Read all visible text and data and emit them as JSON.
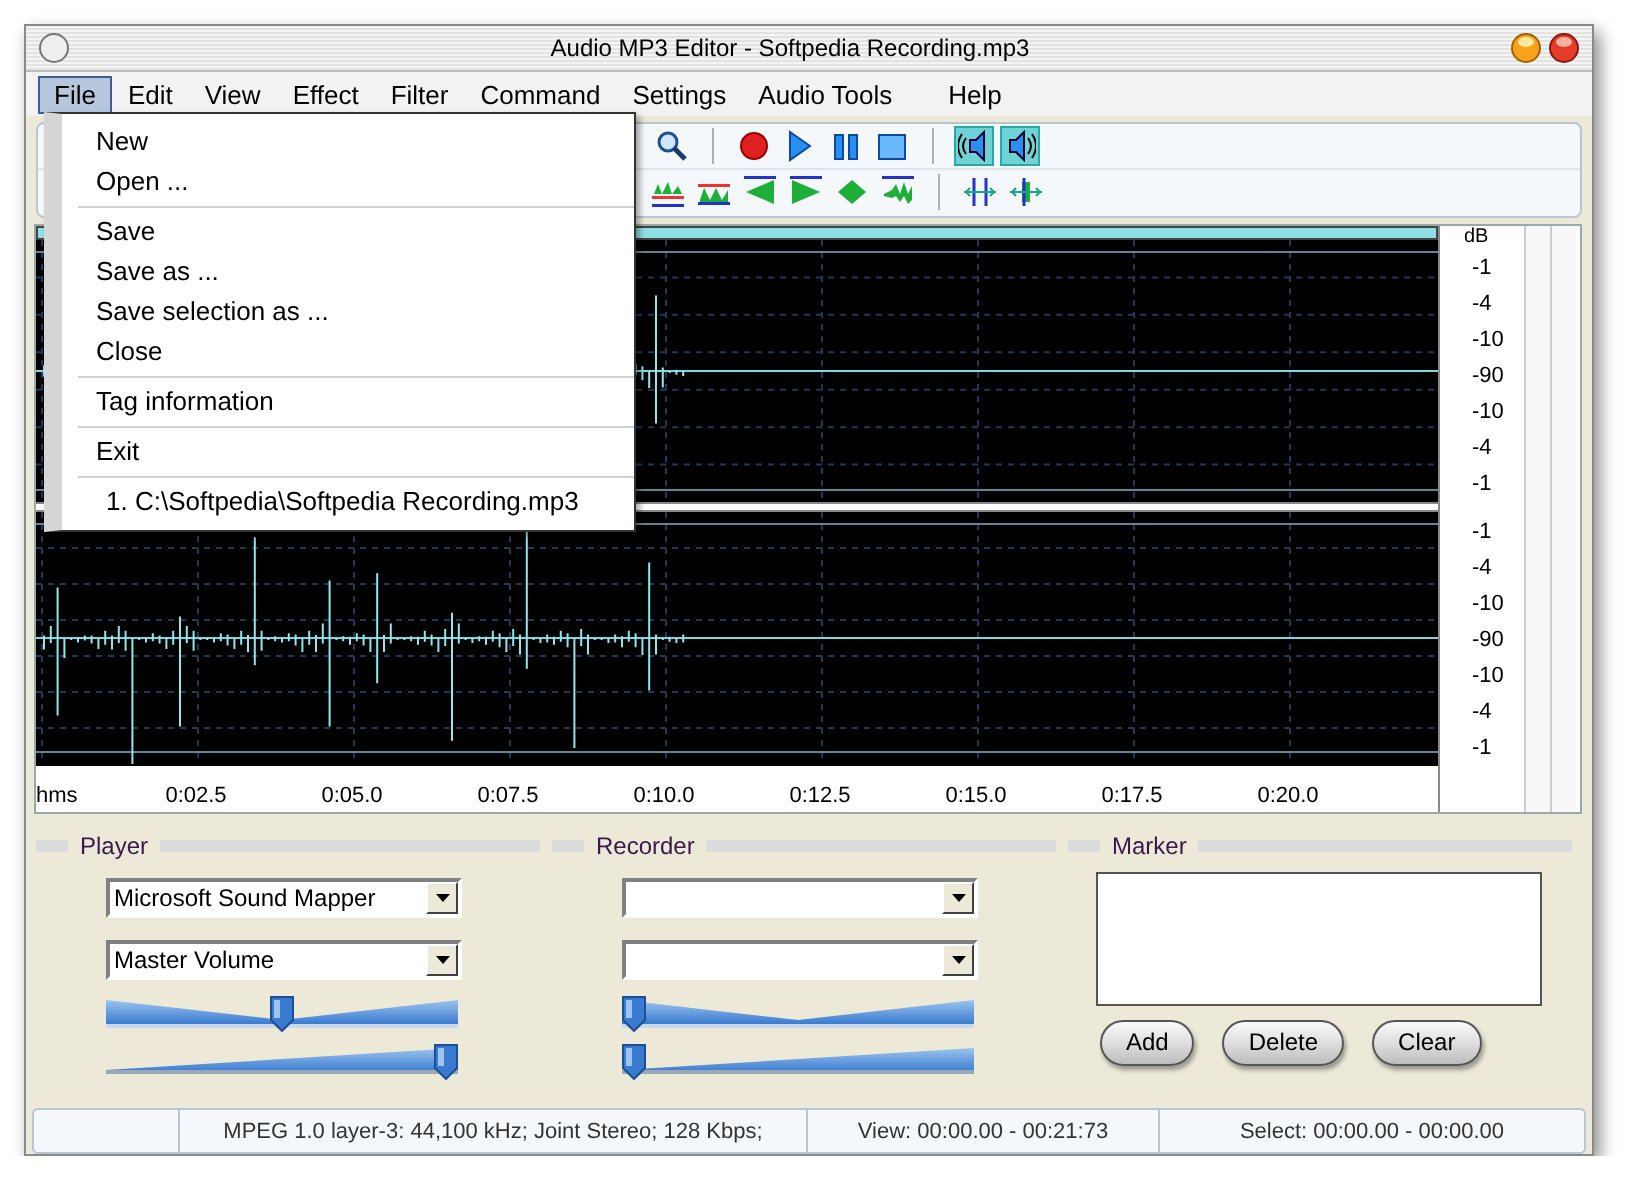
{
  "window": {
    "title": "Audio MP3 Editor - Softpedia Recording.mp3"
  },
  "menu_bar": [
    {
      "label": "File",
      "selected": true
    },
    {
      "label": "Edit",
      "selected": false
    },
    {
      "label": "View",
      "selected": false
    },
    {
      "label": "Effect",
      "selected": false
    },
    {
      "label": "Filter",
      "selected": false
    },
    {
      "label": "Command",
      "selected": false
    },
    {
      "label": "Settings",
      "selected": false
    },
    {
      "label": "Audio Tools",
      "selected": false
    },
    {
      "label": "Help",
      "selected": false
    }
  ],
  "file_menu": {
    "groups": [
      {
        "kind": "command",
        "items": [
          "New",
          "Open ..."
        ]
      },
      {
        "kind": "command",
        "items": [
          "Save",
          "Save as ...",
          "Save selection as ...",
          "Close"
        ]
      },
      {
        "kind": "command",
        "items": [
          "Tag information"
        ]
      },
      {
        "kind": "command",
        "items": [
          "Exit"
        ]
      },
      {
        "kind": "recent",
        "items": [
          "1. C:\\Softpedia\\Softpedia Recording.mp3"
        ]
      }
    ]
  },
  "toolbar": {
    "channel_toggles": [
      {
        "on": true
      },
      {
        "on": true
      }
    ]
  },
  "waveform": {
    "db_label": "dB",
    "channels": [
      {
        "db_ticks": [
          "-1",
          "-4",
          "-10",
          "-90",
          "-10",
          "-4",
          "-1"
        ]
      },
      {
        "db_ticks": [
          "-1",
          "-4",
          "-10",
          "-90",
          "-10",
          "-4",
          "-1"
        ]
      }
    ],
    "time_ruler": [
      "hms",
      "0:02.5",
      "0:05.0",
      "0:07.5",
      "0:10.0",
      "0:12.5",
      "0:15.0",
      "0:17.5",
      "0:20.0"
    ]
  },
  "player": {
    "title": "Player",
    "dropdowns": [
      {
        "kind": "device",
        "value": "Microsoft Sound Mapper"
      },
      {
        "kind": "mixer",
        "value": "Master Volume"
      }
    ],
    "sliders": [
      {
        "kind": "balance",
        "level": 0.5
      },
      {
        "kind": "volume",
        "level": 1
      }
    ]
  },
  "recorder": {
    "title": "Recorder",
    "dropdowns": [
      {
        "kind": "device"
      },
      {
        "kind": "mixer"
      }
    ],
    "sliders": [
      {
        "kind": "balance",
        "level": 0
      },
      {
        "kind": "volume",
        "level": 0
      }
    ]
  },
  "marker": {
    "title": "Marker",
    "buttons": [
      "Add",
      "Delete",
      "Clear"
    ]
  },
  "status_bar": [
    "MPEG 1.0 layer-3: 44,100 kHz; Joint Stereo; 128 Kbps;",
    "View: 00:00.00 - 00:21:73",
    "Select: 00:00.00 - 00:00.00"
  ]
}
